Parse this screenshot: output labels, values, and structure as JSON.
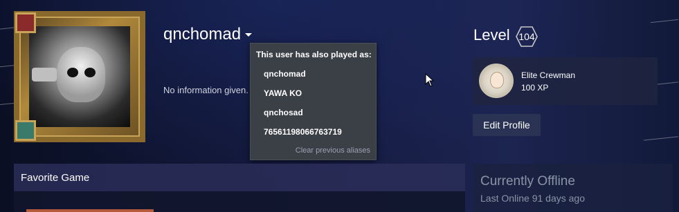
{
  "profile": {
    "persona_name": "qnchomad",
    "summary": "No information given."
  },
  "alias_popup": {
    "title": "This user has also played as:",
    "aliases": [
      "qnchomad",
      "YAWA KO",
      "qnchosad",
      "76561198066763719"
    ],
    "clear_label": "Clear previous aliases"
  },
  "level": {
    "label": "Level",
    "value": "104"
  },
  "featured_badge": {
    "name": "Elite Crewman",
    "xp": "100 XP",
    "icon": "crewman-badge-icon"
  },
  "actions": {
    "edit_profile": "Edit Profile"
  },
  "favorite_game": {
    "title": "Favorite Game"
  },
  "status": {
    "title": "Currently Offline",
    "last_online": "Last Online 91 days ago"
  },
  "colors": {
    "popup_bg": "#3b3f46",
    "panel_bg": "#2a2e58",
    "muted_text": "#8b93a6"
  }
}
